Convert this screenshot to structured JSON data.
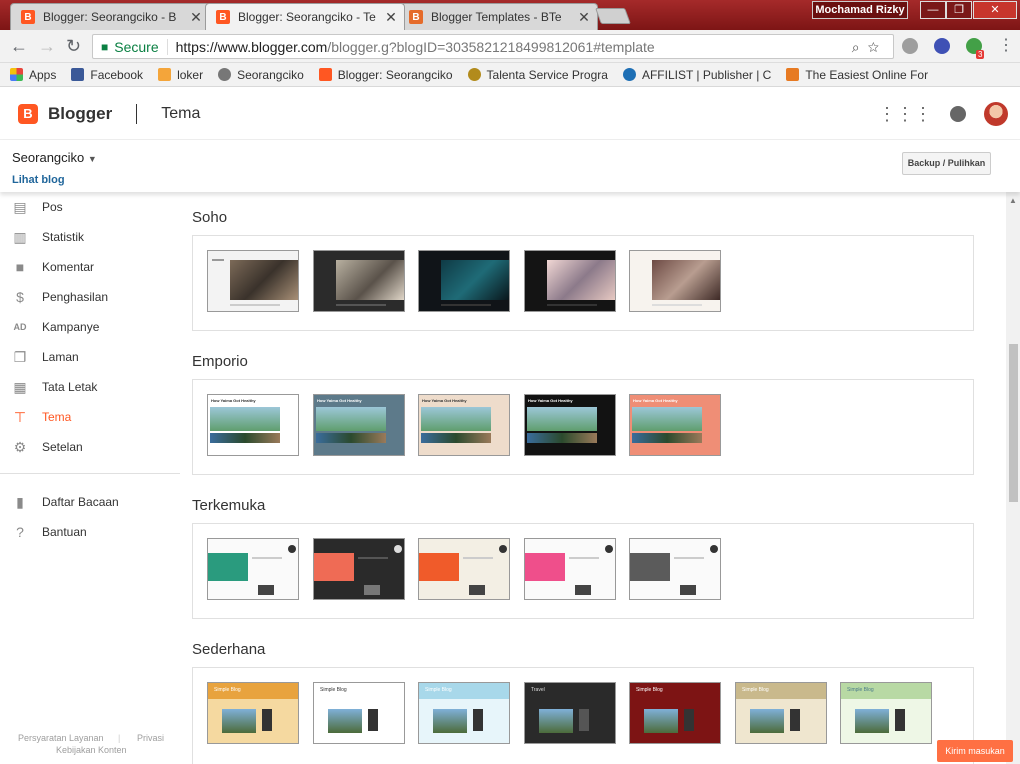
{
  "browser": {
    "tabs": [
      {
        "title": "Blogger: Seorangciko - B",
        "close": "✕"
      },
      {
        "title": "Blogger: Seorangciko - Te",
        "close": "✕"
      },
      {
        "title": "Blogger Templates - BTe",
        "close": "✕"
      }
    ],
    "user_chip": "Mochamad Rizky",
    "address": {
      "secure_label": "Secure",
      "url_host": "https://www.blogger.com",
      "url_rest": "/blogger.g?blogID=3035821218499812061#template"
    },
    "extension_badge": "3",
    "bookmarks": [
      {
        "label": "Apps",
        "color": "#e8453c"
      },
      {
        "label": "Facebook",
        "color": "#3b5998"
      },
      {
        "label": "loker",
        "color": "#f4a53a"
      },
      {
        "label": "Seorangciko",
        "color": "#777777"
      },
      {
        "label": "Blogger: Seorangciko",
        "color": "#ff5722"
      },
      {
        "label": "Talenta Service Progra",
        "color": "#b28b1c"
      },
      {
        "label": "AFFILIST | Publisher | C",
        "color": "#1e6fb5"
      },
      {
        "label": "The Easiest Online For",
        "color": "#e77a22"
      }
    ]
  },
  "app": {
    "brand": "Blogger",
    "page_title": "Tema",
    "blog_name": "Seorangciko",
    "view_blog": "Lihat blog",
    "backup_label": "Backup / Pulihkan",
    "feedback_label": "Kirim masukan"
  },
  "sidebar": {
    "items": [
      {
        "label": "Pos",
        "icon": "posts-icon"
      },
      {
        "label": "Statistik",
        "icon": "stats-icon"
      },
      {
        "label": "Komentar",
        "icon": "comments-icon"
      },
      {
        "label": "Penghasilan",
        "icon": "earnings-icon"
      },
      {
        "label": "Kampanye",
        "icon": "campaigns-icon"
      },
      {
        "label": "Laman",
        "icon": "pages-icon"
      },
      {
        "label": "Tata Letak",
        "icon": "layout-icon"
      },
      {
        "label": "Tema",
        "icon": "theme-icon",
        "active": true
      },
      {
        "label": "Setelan",
        "icon": "settings-icon"
      }
    ],
    "secondary": [
      {
        "label": "Daftar Bacaan",
        "icon": "bookmark-icon"
      },
      {
        "label": "Bantuan",
        "icon": "help-icon"
      }
    ],
    "footer": {
      "terms": "Persyaratan Layanan",
      "privacy": "Privasi",
      "content_policy": "Kebijakan Konten"
    }
  },
  "themes": [
    {
      "name": "Soho",
      "variants": [
        "#f3f3f3",
        "#2b2b2b",
        "#101418",
        "#141414",
        "#f7f3ee"
      ]
    },
    {
      "name": "Emporio",
      "variants": [
        "#ffffff",
        "#5d7a8a",
        "#eedccb",
        "#121212",
        "#ef8e76"
      ]
    },
    {
      "name": "Terkemuka",
      "variants": [
        "#2a9b7e",
        "#ef6b55",
        "#f05b2a",
        "#ef4f8b",
        "#5b5b5b"
      ]
    },
    {
      "name": "Sederhana",
      "variants": [
        "#e8a33e",
        "#ffffff",
        "#a8d8ea",
        "#2a2a2a",
        "#7d1414",
        "#c9b98c",
        "#b8d9a4"
      ],
      "sample_title": "Simple Blog",
      "sample_title_travel": "Travel"
    }
  ],
  "theme_texts": {
    "emporio_headline": "How Yaima Got Healthy"
  }
}
